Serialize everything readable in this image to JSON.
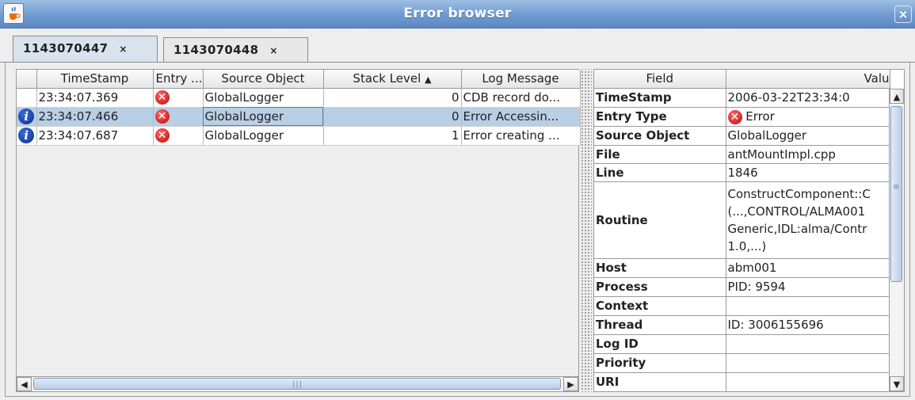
{
  "window": {
    "title": "Error browser"
  },
  "tabs": [
    {
      "label": "1143070447",
      "close": "×"
    },
    {
      "label": "1143070448",
      "close": "×"
    }
  ],
  "log_table": {
    "columns": [
      "",
      "TimeStamp",
      "Entry ...",
      "Source Object",
      "Stack Level",
      "Log Message"
    ],
    "sort_indicator": "▲",
    "rows": [
      {
        "timestamp": "23:34:07.369",
        "source": "GlobalLogger",
        "stack_level": "0",
        "message": "CDB record do..."
      },
      {
        "timestamp": "23:34:07.466",
        "source": "GlobalLogger",
        "stack_level": "0",
        "message": "Error Accessin..."
      },
      {
        "timestamp": "23:34:07.687",
        "source": "GlobalLogger",
        "stack_level": "1",
        "message": "Error creating ..."
      }
    ],
    "scroll_left": "◀",
    "scroll_right": "▶",
    "grip": "|||"
  },
  "details_table": {
    "columns": [
      "Field",
      "Valu"
    ],
    "rows": [
      {
        "field": "TimeStamp",
        "value": "2006-03-22T23:34:0"
      },
      {
        "field": "Entry Type",
        "value": "Error"
      },
      {
        "field": "Source Object",
        "value": "GlobalLogger"
      },
      {
        "field": "File",
        "value": "antMountImpl.cpp"
      },
      {
        "field": "Line",
        "value": "1846"
      },
      {
        "field": "Routine",
        "value": "ConstructComponent::C (...,CONTROL/ALMA001 Generic,IDL:alma/Contr 1.0,...)"
      },
      {
        "field": "Host",
        "value": "abm001"
      },
      {
        "field": "Process",
        "value": "PID: 9594"
      },
      {
        "field": "Context",
        "value": ""
      },
      {
        "field": "Thread",
        "value": "ID: 3006155696"
      },
      {
        "field": "Log ID",
        "value": ""
      },
      {
        "field": "Priority",
        "value": ""
      },
      {
        "field": "URI",
        "value": ""
      }
    ],
    "scroll_up": "▲",
    "scroll_down": "▼"
  },
  "icons": {
    "error": "error-icon",
    "info": "info-icon",
    "java": "java-cup-icon",
    "close": "close-icon"
  },
  "colors": {
    "selection": "#b8cfe5",
    "titlebar": "#6f9ad0",
    "error": "#c10000",
    "info": "#0a2e8a"
  }
}
